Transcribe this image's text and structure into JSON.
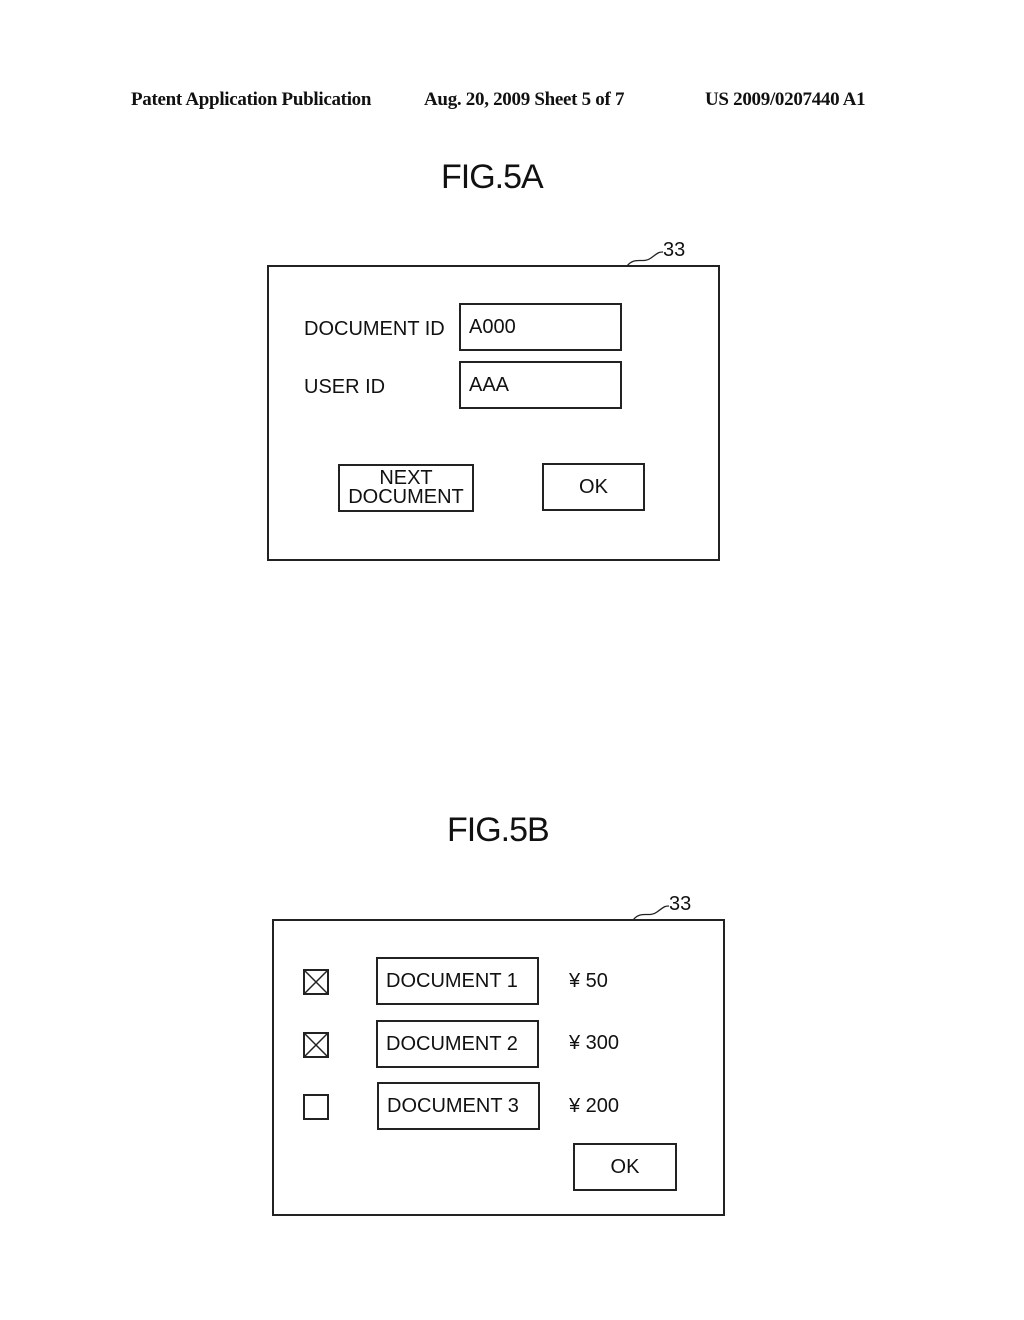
{
  "header": {
    "left": "Patent Application Publication",
    "center": "Aug. 20, 2009  Sheet 5 of 7",
    "right": "US 2009/0207440 A1"
  },
  "fig5a": {
    "title": "FIG.5A",
    "ref": "33",
    "document_id_label": "DOCUMENT ID",
    "document_id_value": "A000",
    "user_id_label": "USER ID",
    "user_id_value": "AAA",
    "next_document_line1": "NEXT",
    "next_document_line2": "DOCUMENT",
    "ok_label": "OK"
  },
  "fig5b": {
    "title": "FIG.5B",
    "ref": "33",
    "items": [
      {
        "label": "DOCUMENT 1",
        "price": "¥  50",
        "checked": true
      },
      {
        "label": "DOCUMENT 2",
        "price": "¥ 300",
        "checked": true
      },
      {
        "label": "DOCUMENT 3",
        "price": "¥ 200",
        "checked": false
      }
    ],
    "ok_label": "OK"
  }
}
